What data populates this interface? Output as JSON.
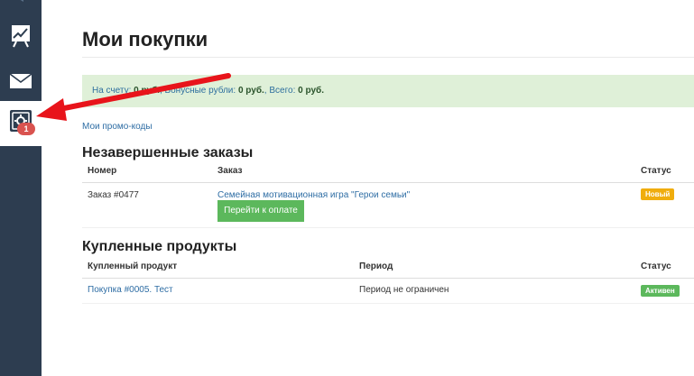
{
  "sidebar": {
    "items": [
      {
        "icon": "chart-board-icon"
      },
      {
        "icon": "mail-icon"
      },
      {
        "icon": "gear-icon",
        "badge": "1"
      }
    ]
  },
  "page": {
    "title": "Мои покупки"
  },
  "balance": {
    "on_account_label": "На счету:",
    "on_account_value": "0 руб.",
    "bonus_label": "Бонусные рубли:",
    "bonus_value": "0 руб.",
    "total_label": "Всего:",
    "total_value": "0 руб."
  },
  "promo_link": "Мои промо-коды",
  "unfinished": {
    "title": "Незавершенные заказы",
    "columns": [
      "Номер",
      "Заказ",
      "Статус"
    ],
    "rows": [
      {
        "number": "Заказ #0477",
        "order": "Семейная мотивационная игра \"Герои семьи\"",
        "button": "Перейти к оплате",
        "status": "Новый",
        "status_color": "#f0ad0e"
      }
    ]
  },
  "purchased": {
    "title": "Купленные продукты",
    "columns": [
      "Купленный продукт",
      "Период",
      "Статус"
    ],
    "rows": [
      {
        "product": "Покупка #0005. Тест",
        "period": "Период не ограничен",
        "status": "Активен",
        "status_color": "#5cb85c"
      }
    ]
  },
  "colors": {
    "sidebar": "#2d3d50",
    "arrow": "#e8141b",
    "link": "#2e6da4",
    "alert_bg": "#dff0d8"
  }
}
